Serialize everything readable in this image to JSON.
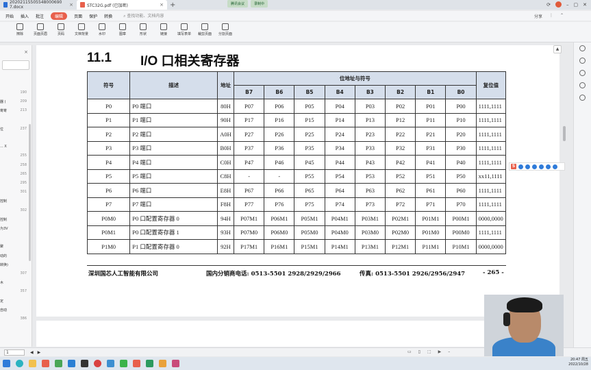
{
  "tabs": [
    {
      "label": "20202115505548000690 7.docx",
      "color": "#2b6fd6"
    },
    {
      "label": "STC32G.pdf (已加密)",
      "color": "#e8604c"
    }
  ],
  "meeting": {
    "btn1": "腾讯会议",
    "btn2": "录制中"
  },
  "window": {
    "share": "分享"
  },
  "menu": {
    "items": [
      "开始",
      "插入",
      "批注",
      "编辑",
      "页面",
      "保护",
      "转换"
    ],
    "active_index": 3,
    "search": "查找功能、文档内容"
  },
  "toolbar": [
    "擦除",
    "页面页眉",
    "页码",
    "文档背景",
    "水印",
    "图章",
    "形状",
    "链接",
    "填写表单",
    "裁剪页面",
    "分割页面"
  ],
  "leftpanel": {
    "items": [
      {
        "text": "",
        "num": "190"
      },
      {
        "text": "器 (",
        "num": "209"
      },
      {
        "text": "寄寄",
        "num": "213"
      },
      {
        "text": "",
        "num": ""
      },
      {
        "text": "位",
        "num": "237"
      },
      {
        "text": "",
        "num": ""
      },
      {
        "text": "... X",
        "num": ""
      },
      {
        "text": "",
        "num": "255"
      },
      {
        "text": "",
        "num": "258"
      },
      {
        "text": "",
        "num": "265"
      },
      {
        "text": "",
        "num": "295"
      },
      {
        "text": "",
        "num": "301"
      },
      {
        "text": "控制",
        "num": ""
      },
      {
        "text": "",
        "num": "302"
      },
      {
        "text": "控制",
        "num": ""
      },
      {
        "text": "为3V",
        "num": ""
      },
      {
        "text": "",
        "num": ""
      },
      {
        "text": "聚",
        "num": ""
      },
      {
        "text": "动的",
        "num": ""
      },
      {
        "text": "转换)",
        "num": ""
      },
      {
        "text": "",
        "num": "307"
      },
      {
        "text": "木",
        "num": ""
      },
      {
        "text": "",
        "num": "357"
      },
      {
        "text": "定",
        "num": ""
      },
      {
        "text": "自动",
        "num": ""
      },
      {
        "text": "",
        "num": "386"
      }
    ]
  },
  "document": {
    "section_number": "11.1",
    "section_title": "I/O 口相关寄存器",
    "header": {
      "symbol": "符号",
      "description": "描述",
      "address": "地址",
      "bits_group": "位地址与符号",
      "reset": "复位值",
      "bits": [
        "B7",
        "B6",
        "B5",
        "B4",
        "B3",
        "B2",
        "B1",
        "B0"
      ]
    },
    "rows": [
      {
        "symbol": "P0",
        "desc": "P0 端口",
        "addr": "80H",
        "bits": [
          "P07",
          "P06",
          "P05",
          "P04",
          "P03",
          "P02",
          "P01",
          "P00"
        ],
        "reset": "1111,1111"
      },
      {
        "symbol": "P1",
        "desc": "P1 端口",
        "addr": "90H",
        "bits": [
          "P17",
          "P16",
          "P15",
          "P14",
          "P13",
          "P12",
          "P11",
          "P10"
        ],
        "reset": "1111,1111"
      },
      {
        "symbol": "P2",
        "desc": "P2 端口",
        "addr": "A0H",
        "bits": [
          "P27",
          "P26",
          "P25",
          "P24",
          "P23",
          "P22",
          "P21",
          "P20"
        ],
        "reset": "1111,1111"
      },
      {
        "symbol": "P3",
        "desc": "P3 端口",
        "addr": "B0H",
        "bits": [
          "P37",
          "P36",
          "P35",
          "P34",
          "P33",
          "P32",
          "P31",
          "P30"
        ],
        "reset": "1111,1111"
      },
      {
        "symbol": "P4",
        "desc": "P4 端口",
        "addr": "C0H",
        "bits": [
          "P47",
          "P46",
          "P45",
          "P44",
          "P43",
          "P42",
          "P41",
          "P40"
        ],
        "reset": "1111,1111"
      },
      {
        "symbol": "P5",
        "desc": "P5 端口",
        "addr": "C8H",
        "bits": [
          "-",
          "-",
          "P55",
          "P54",
          "P53",
          "P52",
          "P51",
          "P50"
        ],
        "reset": "xx11,1111"
      },
      {
        "symbol": "P6",
        "desc": "P6 端口",
        "addr": "E8H",
        "bits": [
          "P67",
          "P66",
          "P65",
          "P64",
          "P63",
          "P62",
          "P61",
          "P60"
        ],
        "reset": "1111,1111"
      },
      {
        "symbol": "P7",
        "desc": "P7 端口",
        "addr": "F8H",
        "bits": [
          "P77",
          "P76",
          "P75",
          "P74",
          "P73",
          "P72",
          "P71",
          "P70"
        ],
        "reset": "1111,1111"
      },
      {
        "symbol": "P0M0",
        "desc": "P0 口配置寄存器 0",
        "addr": "94H",
        "bits": [
          "P07M1",
          "P06M1",
          "P05M1",
          "P04M1",
          "P03M1",
          "P02M1",
          "P01M1",
          "P00M1"
        ],
        "reset": "0000,0000"
      },
      {
        "symbol": "P0M1",
        "desc": "P0 口配置寄存器 1",
        "addr": "93H",
        "bits": [
          "P07M0",
          "P06M0",
          "P05M0",
          "P04M0",
          "P03M0",
          "P02M0",
          "P01M0",
          "P00M0"
        ],
        "reset": "1111,1111"
      },
      {
        "symbol": "P1M0",
        "desc": "P1 口配置寄存器 0",
        "addr": "92H",
        "bits": [
          "P17M1",
          "P16M1",
          "P15M1",
          "P14M1",
          "P13M1",
          "P12M1",
          "P11M1",
          "P10M1"
        ],
        "reset": "0000,0000"
      }
    ],
    "footer": {
      "company": "深圳国芯人工智能有限公司",
      "phone": "国内分销商电话: 0513-5501 2928/2929/2966",
      "fax": "传真: 0513-5501 2926/2956/2947",
      "page": "- 265 -"
    }
  },
  "statusbar": {
    "page_box": "1"
  },
  "tray": {
    "time": "20:47 周五",
    "date": "2022/10/28"
  }
}
